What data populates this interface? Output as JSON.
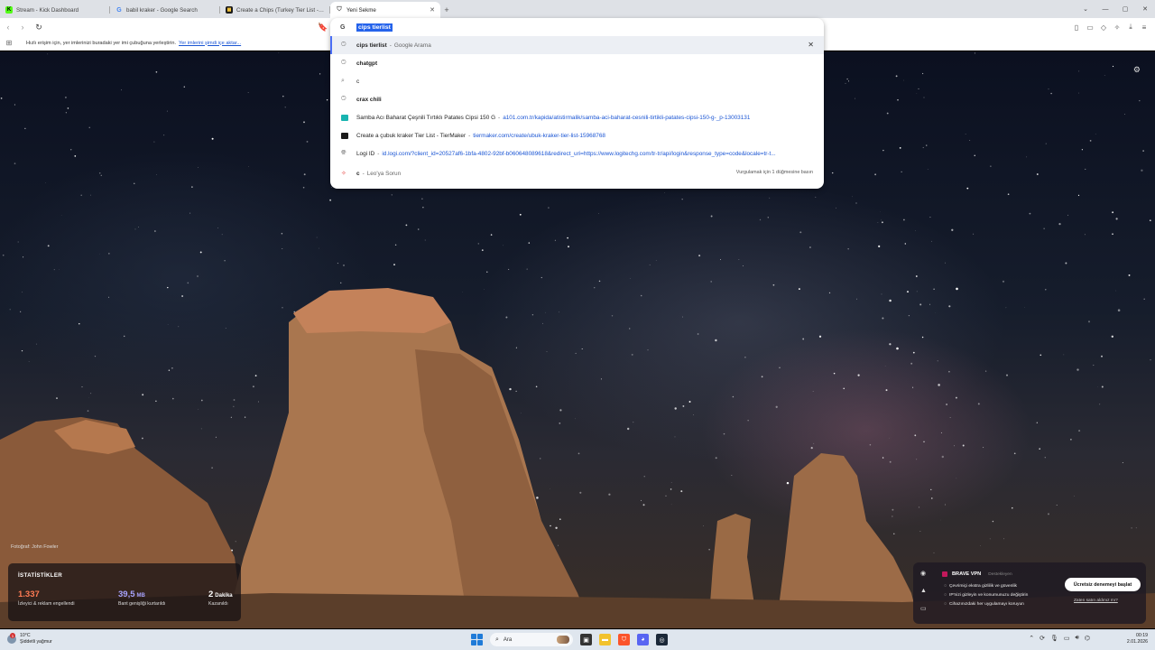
{
  "tabs": [
    {
      "label": "Stream - Kick Dashboard",
      "icon": "kick-icon",
      "active": false
    },
    {
      "label": "babil kraker - Google Search",
      "icon": "google-icon",
      "active": false
    },
    {
      "label": "Create a Chips (Turkey Tier List - Tier...",
      "icon": "tiermaker-icon",
      "active": false
    },
    {
      "label": "Yeni Sekme",
      "icon": "brave-icon",
      "active": true
    }
  ],
  "bookmarks_bar": {
    "text": "Hızlı erişim için, yer imlerinizi buradaki yer imi çubuğuna yerleştirin.",
    "link": "Yer imlerini şimdi içe aktar..."
  },
  "omnibox": {
    "query": "cips tierlist",
    "search_engine_icon": "G",
    "suggestions": [
      {
        "type": "history",
        "icon": "history-icon",
        "text": "cips tierlist",
        "desc": "Google Arama",
        "selected": true,
        "removable": true
      },
      {
        "type": "history",
        "icon": "history-icon",
        "text": "chatgpt"
      },
      {
        "type": "search",
        "icon": "search-icon",
        "text": "c"
      },
      {
        "type": "history",
        "icon": "history-icon",
        "text": "crax chili"
      },
      {
        "type": "site",
        "icon": "a101-icon",
        "text": "Samba Acı Baharat Çeşnili Tırtıklı Patates Cipsi 150 G",
        "url": "a101.com.tr/kapida/atistirmalik/samba-aci-baharat-cesnili-tirtikli-patates-cipsi-150-g-_p-13003131"
      },
      {
        "type": "site",
        "icon": "tiermaker-icon",
        "text": "Create a çubuk kraker Tier List - TierMaker",
        "url": "tiermaker.com/create/ubuk-kraker-tier-list-15968768"
      },
      {
        "type": "site",
        "icon": "globe-icon",
        "text": "Logi ID",
        "url": "id.logi.com/?client_id=20527af6-1bfa-4802-92bf-b060648089618&redirect_uri=https://www.logitechg.com/tr-tr/api/login&response_type=code&locale=tr-t..."
      }
    ],
    "leo": {
      "query": "c",
      "desc": "Leo'ya Sorun",
      "hint": "Vurgulamak için 1 düğmesine basın"
    }
  },
  "ntp": {
    "photo_credit": "Fotoğraf: John Fowler",
    "stats": {
      "title": "İSTATİSTİKLER",
      "items": [
        {
          "value": "1.337",
          "unit": "",
          "label": "İzleyici & reklam engellendi"
        },
        {
          "value": "39,5",
          "unit": "MB",
          "label": "Bant genişliği kurtarıldı"
        },
        {
          "value": "2",
          "unit": "Dakika",
          "label": "Kazanıldı"
        }
      ]
    },
    "vpn": {
      "title": "BRAVE VPN",
      "subtitle": "Destekleyen",
      "features": [
        "Çevrimiçi ekstra gizlilik ve güvenlik",
        "IP'nizi gizleyin ve konumunuzu değiştirin",
        "Cihazınızdaki her uygulamayı koruyun"
      ],
      "cta": "Ücretsiz denemeyi başlat",
      "more": "Zaten satın aldınız mı?"
    }
  },
  "taskbar": {
    "weather_temp": "10°C",
    "weather_desc": "Şiddetli yağmur",
    "weather_alert": "1",
    "search_placeholder": "Ara",
    "time": "00:19",
    "date": "2.01.2026"
  },
  "colors": {
    "accent": "#2563eb",
    "stat_trackers": "#ff7b54",
    "stat_bandwidth": "#a7a3ff",
    "brave": "#fb542b"
  }
}
